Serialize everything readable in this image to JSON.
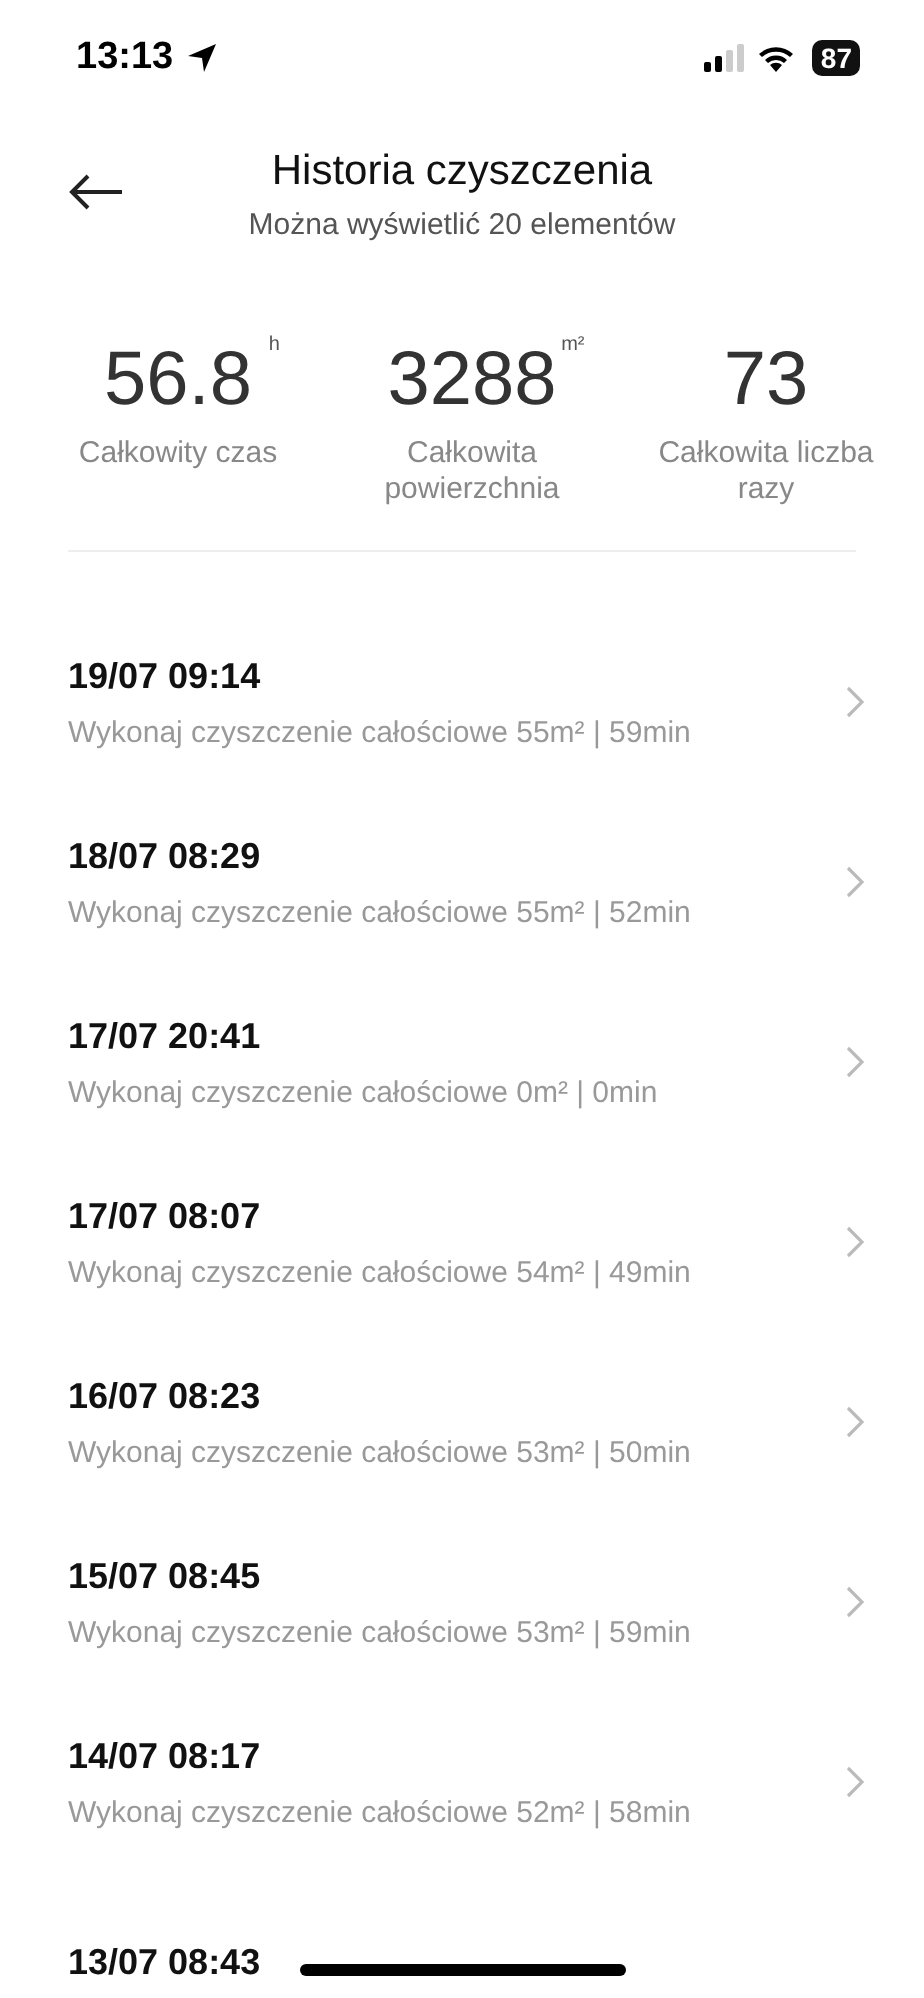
{
  "status_bar": {
    "time": "13:13",
    "battery": "87"
  },
  "header": {
    "title": "Historia czyszczenia",
    "subtitle": "Można wyświetlić 20 elementów"
  },
  "stats": [
    {
      "value": "56.8",
      "unit": "h",
      "label": "Całkowity czas"
    },
    {
      "value": "3288",
      "unit": "m²",
      "label": "Całkowita powierzchnia"
    },
    {
      "value": "73",
      "label": "Całkowita liczba razy"
    }
  ],
  "records": [
    {
      "date": "19/07 09:14",
      "summary": "Wykonaj czyszczenie całościowe 55m² | 59min"
    },
    {
      "date": "18/07 08:29",
      "summary": "Wykonaj czyszczenie całościowe 55m² | 52min"
    },
    {
      "date": "17/07 20:41",
      "summary": "Wykonaj czyszczenie całościowe 0m² | 0min"
    },
    {
      "date": "17/07 08:07",
      "summary": "Wykonaj czyszczenie całościowe 54m² | 49min"
    },
    {
      "date": "16/07 08:23",
      "summary": "Wykonaj czyszczenie całościowe 53m² | 50min"
    },
    {
      "date": "15/07 08:45",
      "summary": "Wykonaj czyszczenie całościowe 53m² | 59min"
    },
    {
      "date": "14/07 08:17",
      "summary": "Wykonaj czyszczenie całościowe 52m² | 58min"
    },
    {
      "date": "13/07 08:43"
    }
  ]
}
